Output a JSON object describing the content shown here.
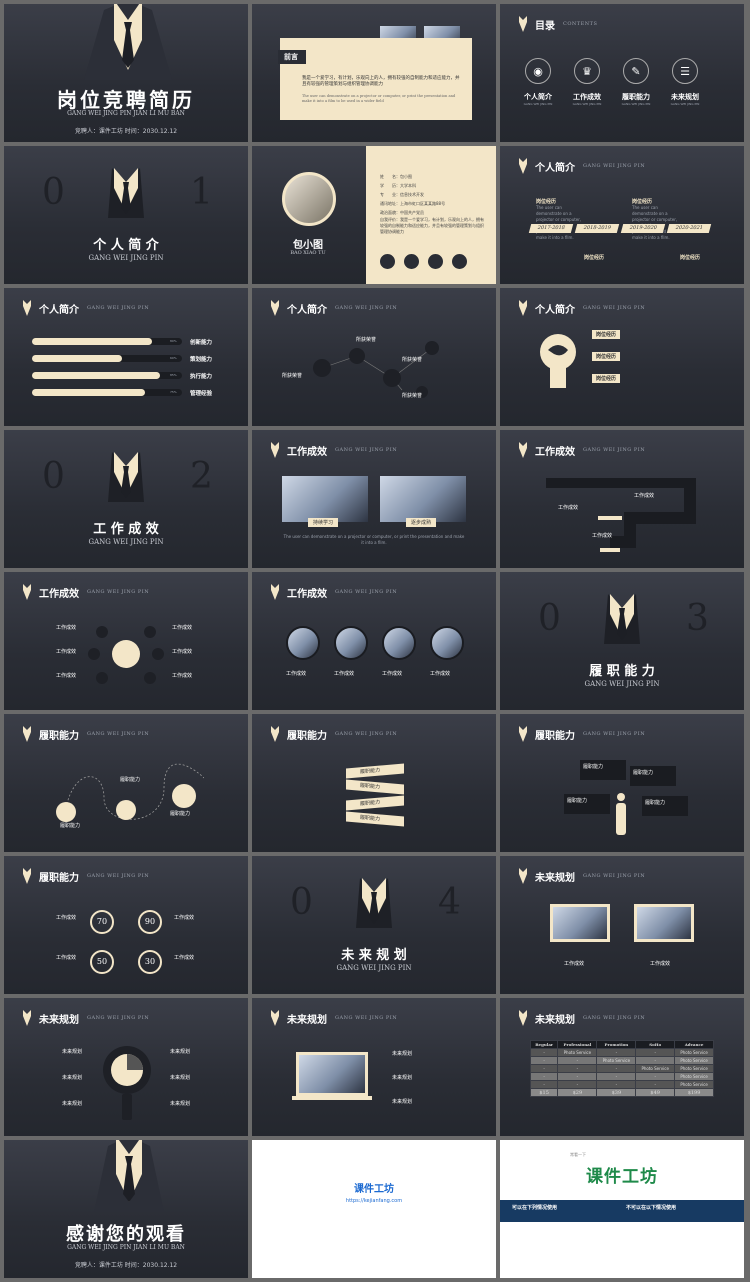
{
  "cover": {
    "title": "岗位竞聘简历",
    "subtitle": "GANG WEI JING PIN JIAN LI MU BAN",
    "meta": "竞聘人：课件工坊   时间：2030.12.12"
  },
  "preface": {
    "title": "前言",
    "body": "我是一个爱学习，有计划，乐观向上的人，拥有较强的自制能力和适应能力，并且有较强的管理策划与组织管理协调能力",
    "en": "The user can demonstrate on a projector or computer, or print the presentation and make it into a film to be used in a wider field"
  },
  "toc": {
    "title": "目录",
    "sub": "CONTENTS",
    "items": [
      {
        "label": "个人简介",
        "sub": "GANG WEI JING PIN",
        "icon": "user-icon"
      },
      {
        "label": "工作成效",
        "sub": "GANG WEI JING PIN",
        "icon": "trophy-icon"
      },
      {
        "label": "履职能力",
        "sub": "GANG WEI JING PIN",
        "icon": "wrench-icon"
      },
      {
        "label": "未来规划",
        "sub": "GANG WEI JING PIN",
        "icon": "clipboard-icon"
      }
    ]
  },
  "sections": [
    {
      "left": "0",
      "right": "1",
      "title": "个 人 简 介",
      "sub": "GANG WEI JING PIN"
    },
    {
      "left": "0",
      "right": "2",
      "title": "工 作 成 效",
      "sub": "GANG WEI JING PIN"
    },
    {
      "left": "0",
      "right": "3",
      "title": "履 职 能 力",
      "sub": "GANG WEI JING PIN"
    },
    {
      "left": "0",
      "right": "4",
      "title": "未 来 规 划",
      "sub": "GANG WEI JING PIN"
    }
  ],
  "profile": {
    "name": "包小图",
    "name_en": "BAO XIAO TU",
    "fields": [
      "姓　　名：包小图",
      "学　　历：大学本科",
      "专　　业：信息技术开发",
      "通讯地址：上海市虹口区某某路88号",
      "政治面貌：中国共产党员",
      "自我评价：我是一个爱学习，有计划，乐观向上的人，拥有较强的自制能力和适应能力，并且有较强的管理策划与组织管理协调能力"
    ]
  },
  "headers": {
    "personal": "个人简介",
    "work": "工作成效",
    "ability": "履职能力",
    "future": "未来规划",
    "en": "GANG WEI JING PIN"
  },
  "timeline": {
    "items": [
      "岗位经历",
      "岗位经历",
      "岗位经历",
      "岗位经历"
    ],
    "years": [
      "2017-2018",
      "2018-2019",
      "2019-2020",
      "2020-2021"
    ]
  },
  "skills": [
    {
      "label": "创新能力",
      "pct": 0.8,
      "pct_text": "80%"
    },
    {
      "label": "策划能力",
      "pct": 0.6,
      "pct_text": "60%"
    },
    {
      "label": "执行能力",
      "pct": 0.85,
      "pct_text": "85%"
    },
    {
      "label": "管理经验",
      "pct": 0.75,
      "pct_text": "75%"
    }
  ],
  "honors": [
    "所获荣誉",
    "所获荣誉",
    "所获荣誉",
    "所获荣誉"
  ],
  "bulb_items": [
    "岗位经历",
    "岗位经历",
    "岗位经历"
  ],
  "work_photos": [
    "持续学习",
    "逐步成熟"
  ],
  "work_item": "工作成效",
  "ability_item": "履职能力",
  "future_item": "未来规划",
  "rings": [
    "70",
    "90",
    "50",
    "30"
  ],
  "table": {
    "headers": [
      "Regular",
      "Professional",
      "Promotion",
      "SoHo",
      "Advance"
    ],
    "cell": "Photo Service",
    "prices": [
      "$15",
      "$29",
      "$39",
      "$49",
      "$199"
    ]
  },
  "thanks": {
    "title": "感谢您的观看",
    "subtitle": "GANG WEI JING PIN JIAN LI MU BAN",
    "meta": "竞聘人：课件工坊   时间：2030.12.12"
  },
  "brand": {
    "name": "课件工坊",
    "url": "https://kejianfang.com",
    "sub": "常看一下",
    "can_use": "可以在下列情况使用",
    "cannot_use": "不可以在以下情况使用"
  },
  "en_para": "The user can demonstrate on a projector or computer, or print the presentation and make it into a film."
}
